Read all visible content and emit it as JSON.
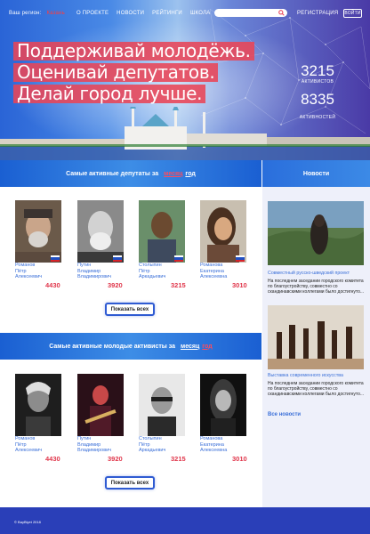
{
  "nav": {
    "region_label": "Ваш регион:",
    "region_value": "Казань",
    "links": [
      "О проекте",
      "Новости",
      "Рейтинги",
      "Школа"
    ],
    "register": "Регистрация",
    "login": "Войти"
  },
  "hero": {
    "slogan": [
      "Поддерживай молодёжь.",
      "Оценивай депутатов.",
      "Делай город лучше."
    ],
    "stats": [
      {
        "value": "3215",
        "label": "активистов"
      },
      {
        "value": "8335",
        "label": "активностей"
      }
    ]
  },
  "deputies": {
    "header_prefix": "Самые активные депутаты за",
    "period_month": "месяц",
    "period_year": "год",
    "show_all": "Показать всех",
    "people": [
      {
        "surname": "Романов",
        "first": "Пётр",
        "patronymic": "Алексеевич",
        "score": "4430"
      },
      {
        "surname": "Путин",
        "first": "Владимир",
        "patronymic": "Владимирович",
        "score": "3920"
      },
      {
        "surname": "Столыпин",
        "first": "Пётр",
        "patronymic": "Аркадьевич",
        "score": "3215"
      },
      {
        "surname": "Романова",
        "first": "Екатерина",
        "patronymic": "Алексеевна",
        "score": "3010"
      }
    ]
  },
  "activists": {
    "header_prefix": "Самые активные молодые активисты за",
    "period_month": "месяц",
    "period_year": "год",
    "show_all": "Показать всех",
    "people": [
      {
        "surname": "Романов",
        "first": "Пётр",
        "patronymic": "Алексеевич",
        "score": "4430"
      },
      {
        "surname": "Путин",
        "first": "Владимир",
        "patronymic": "Владимирович",
        "score": "3920"
      },
      {
        "surname": "Столыпин",
        "first": "Пётр",
        "patronymic": "Аркадьевич",
        "score": "3215"
      },
      {
        "surname": "Романова",
        "first": "Екатерина",
        "patronymic": "Алексеевна",
        "score": "3010"
      }
    ]
  },
  "news": {
    "header": "Новости",
    "items": [
      {
        "title": "Совместный русско-шведский проект",
        "text": "На последнем заседании городского комитета по благоустройству, совместно со скандинавскими коллегами было достигнуто..."
      },
      {
        "title": "Выставка современного искусства",
        "text": "На последнем заседании городского комитета по благоустройству, совместно со скандинавскими коллегами было достигнуто..."
      }
    ],
    "all_news": "Все новости"
  },
  "footer": {
    "copyright": "© BayBiyet 2018"
  },
  "colors": {
    "accent": "#e9445a",
    "primary": "#1a5fd2",
    "footer": "#2a3fb8"
  }
}
